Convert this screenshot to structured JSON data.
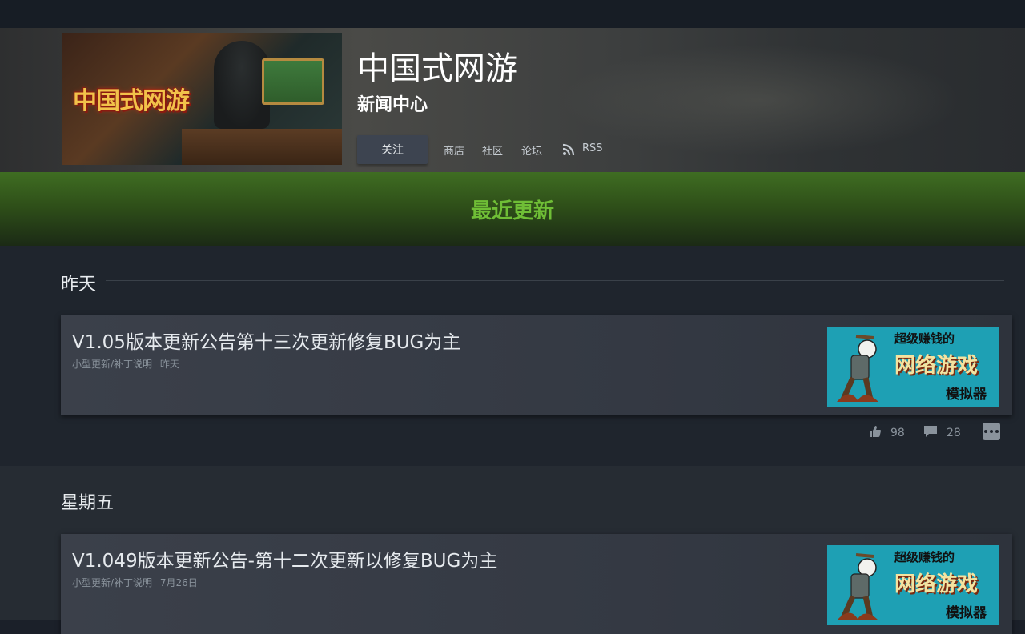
{
  "header": {
    "game_title": "中国式网游",
    "subtitle": "新闻中心",
    "capsule_logo": "中国式网游",
    "follow_label": "关注",
    "nav": [
      {
        "label": "商店"
      },
      {
        "label": "社区"
      },
      {
        "label": "论坛"
      },
      {
        "label": "RSS",
        "icon": "rss-icon"
      }
    ]
  },
  "banner": {
    "label": "最近更新"
  },
  "sections": [
    {
      "day": "昨天",
      "post": {
        "title": "V1.05版本更新公告第十三次更新修复BUG为主",
        "category": "小型更新/补丁说明",
        "date": "昨天",
        "thumb": {
          "line1": "超级赚钱的",
          "line2": "网络游戏",
          "line3": "模拟器"
        },
        "likes": "98",
        "comments": "28"
      }
    },
    {
      "day": "星期五",
      "post": {
        "title": "V1.049版本更新公告-第十二次更新以修复BUG为主",
        "category": "小型更新/补丁说明",
        "date": "7月26日",
        "thumb": {
          "line1": "超级赚钱的",
          "line2": "网络游戏",
          "line3": "模拟器"
        }
      }
    }
  ],
  "colors": {
    "banner_text": "#6fbe36",
    "thumb_bg": "#1ea0b4",
    "page_bg": "#1b2029"
  }
}
